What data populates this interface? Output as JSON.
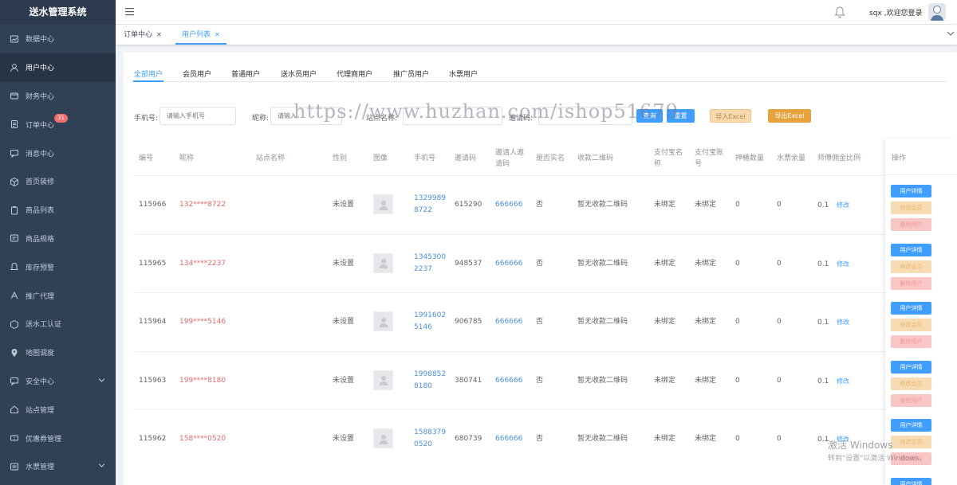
{
  "app": {
    "title": "送水管理系统"
  },
  "sidebar": {
    "items": [
      {
        "label": "数据中心",
        "icon": "chart-icon"
      },
      {
        "label": "用户中心",
        "icon": "user-icon",
        "active": true
      },
      {
        "label": "财务中心",
        "icon": "wallet-icon"
      },
      {
        "label": "订单中心",
        "icon": "document-icon",
        "badge": "31"
      },
      {
        "label": "消息中心",
        "icon": "message-icon"
      },
      {
        "label": "首页装修",
        "icon": "cube-icon"
      },
      {
        "label": "商品列表",
        "icon": "clipboard-icon"
      },
      {
        "label": "商品规格",
        "icon": "spec-icon"
      },
      {
        "label": "库存预警",
        "icon": "bell-icon"
      },
      {
        "label": "推广代理",
        "icon": "agent-icon"
      },
      {
        "label": "送水工认证",
        "icon": "box-icon"
      },
      {
        "label": "地图调度",
        "icon": "location-icon"
      },
      {
        "label": "安全中心",
        "icon": "message-icon",
        "has_arrow": true
      },
      {
        "label": "站点管理",
        "icon": "home-icon"
      },
      {
        "label": "优惠券管理",
        "icon": "coupon-icon"
      },
      {
        "label": "水票管理",
        "icon": "ticket-icon",
        "has_arrow": true
      }
    ]
  },
  "header": {
    "welcome": "sqx ,欢迎您登录"
  },
  "tabs": [
    {
      "label": "订单中心",
      "close": "✕"
    },
    {
      "label": "用户列表",
      "close": "✕"
    }
  ],
  "subtabs": [
    "全部用户",
    "会员用户",
    "普通用户",
    "送水员用户",
    "代理商用户",
    "推广员用户",
    "水票用户"
  ],
  "filters": {
    "phone_label": "手机号:",
    "phone_placeholder": "请输入手机号",
    "nick_label": "昵称:",
    "nick_placeholder": "请输入",
    "site_label": "站点名称:",
    "invite_label": "邀请码:",
    "search_btn": "查询",
    "reset_btn": "重置",
    "import_btn": "导入Excel",
    "export_btn": "导出Excel"
  },
  "watermark": "https://www.huzhan.com/ishop51679",
  "table": {
    "headers": {
      "id": "编号",
      "nick": "昵称",
      "site": "站点名称",
      "gender": "性别",
      "avatar": "图像",
      "phone": "手机号",
      "code": "邀请码",
      "inviter_l1": "邀请人邀",
      "inviter_l2": "请码",
      "realname": "是否实名",
      "qr": "收款二维码",
      "alipay_name_l1": "支付宝名",
      "alipay_name_l2": "称",
      "alipay_acc_l1": "支付宝账",
      "alipay_acc_l2": "号",
      "deposit": "押桶数量",
      "tickets": "水票余量",
      "commission": "师傅佣金比例",
      "ops": "操作"
    },
    "rows": [
      {
        "id": "115966",
        "nick": "132****8722",
        "gender": "未设置",
        "phone_l1": "1329989",
        "phone_l2": "8722",
        "code": "615290",
        "inviter": "666666",
        "realname": "否",
        "qr": "暂无收款二维码",
        "alipay_name": "未绑定",
        "alipay_acc": "未绑定",
        "deposit": "0",
        "tickets": "0",
        "commission": "0.1",
        "edit": "修改"
      },
      {
        "id": "115965",
        "nick": "134****2237",
        "gender": "未设置",
        "phone_l1": "1345300",
        "phone_l2": "2237",
        "code": "948537",
        "inviter": "666666",
        "realname": "否",
        "qr": "暂无收款二维码",
        "alipay_name": "未绑定",
        "alipay_acc": "未绑定",
        "deposit": "0",
        "tickets": "0",
        "commission": "0.1",
        "edit": "修改"
      },
      {
        "id": "115964",
        "nick": "199****5146",
        "gender": "未设置",
        "phone_l1": "1991602",
        "phone_l2": "5146",
        "code": "906785",
        "inviter": "666666",
        "realname": "否",
        "qr": "暂无收款二维码",
        "alipay_name": "未绑定",
        "alipay_acc": "未绑定",
        "deposit": "0",
        "tickets": "0",
        "commission": "0.1",
        "edit": "修改"
      },
      {
        "id": "115963",
        "nick": "199****8180",
        "gender": "未设置",
        "phone_l1": "1998852",
        "phone_l2": "8180",
        "code": "380741",
        "inviter": "666666",
        "realname": "否",
        "qr": "暂无收款二维码",
        "alipay_name": "未绑定",
        "alipay_acc": "未绑定",
        "deposit": "0",
        "tickets": "0",
        "commission": "0.1",
        "edit": "修改"
      },
      {
        "id": "115962",
        "nick": "158****0520",
        "gender": "未设置",
        "phone_l1": "1588379",
        "phone_l2": "0520",
        "code": "680739",
        "inviter": "666666",
        "realname": "否",
        "qr": "暂无收款二维码",
        "alipay_name": "未绑定",
        "alipay_acc": "未绑定",
        "deposit": "0",
        "tickets": "0",
        "commission": "0.1",
        "edit": "修改"
      }
    ],
    "ops": {
      "detail": "用户详情",
      "vip": "修改会员",
      "delete": "删除用户"
    }
  },
  "os_watermark": {
    "line1": "激活 Windows",
    "line2": "转到\"设置\"以激活 Windows。"
  },
  "colors": {
    "sidebar_bg": "#304156",
    "accent": "#409eff",
    "danger_text": "#e06b6b",
    "warning": "#e6a23c"
  }
}
